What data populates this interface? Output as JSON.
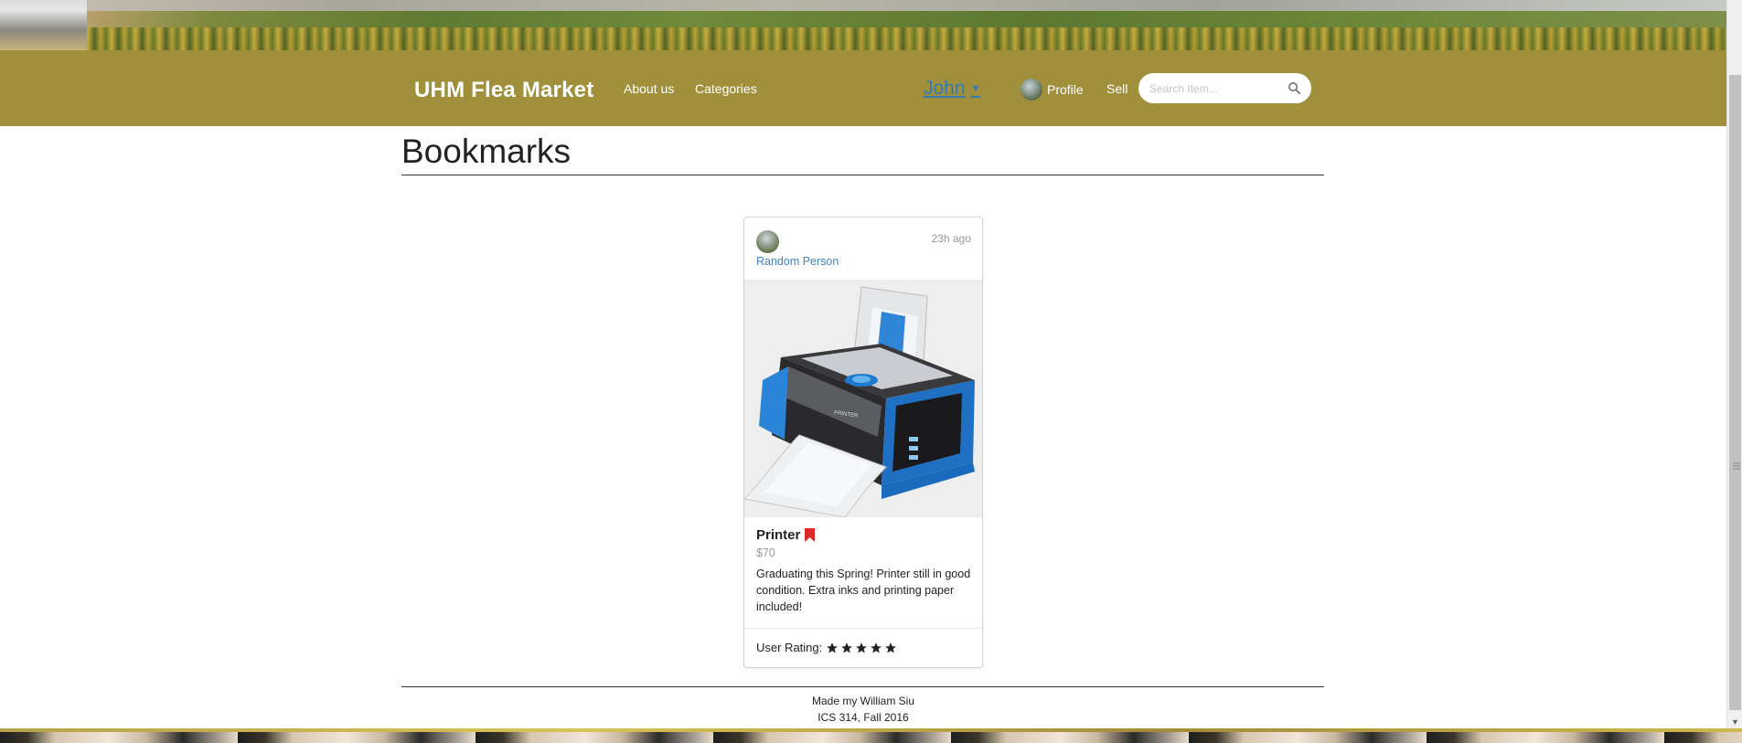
{
  "navbar": {
    "brand": "UHM Flea Market",
    "about_label": "About us",
    "categories_label": "Categories",
    "user_name": "John",
    "profile_label": "Profile",
    "sell_label": "Sell",
    "search_placeholder": "Search Item..."
  },
  "page": {
    "title": "Bookmarks"
  },
  "card": {
    "seller_name": "Random Person",
    "time_ago": "23h ago",
    "item_name": "Printer",
    "price": "$70",
    "description": "Graduating this Spring! Printer still in good condition. Extra inks and printing paper included!",
    "rating_label": "User Rating:",
    "rating_stars": 5,
    "bookmark_color": "#db2828",
    "image_label": "PRINTER"
  },
  "footer": {
    "line1": "Made my William Siu",
    "line2": "ICS 314, Fall 2016"
  },
  "colors": {
    "navbar_bg": "#a0903c",
    "link_blue": "#4183c4",
    "user_blue": "#337ab7"
  }
}
